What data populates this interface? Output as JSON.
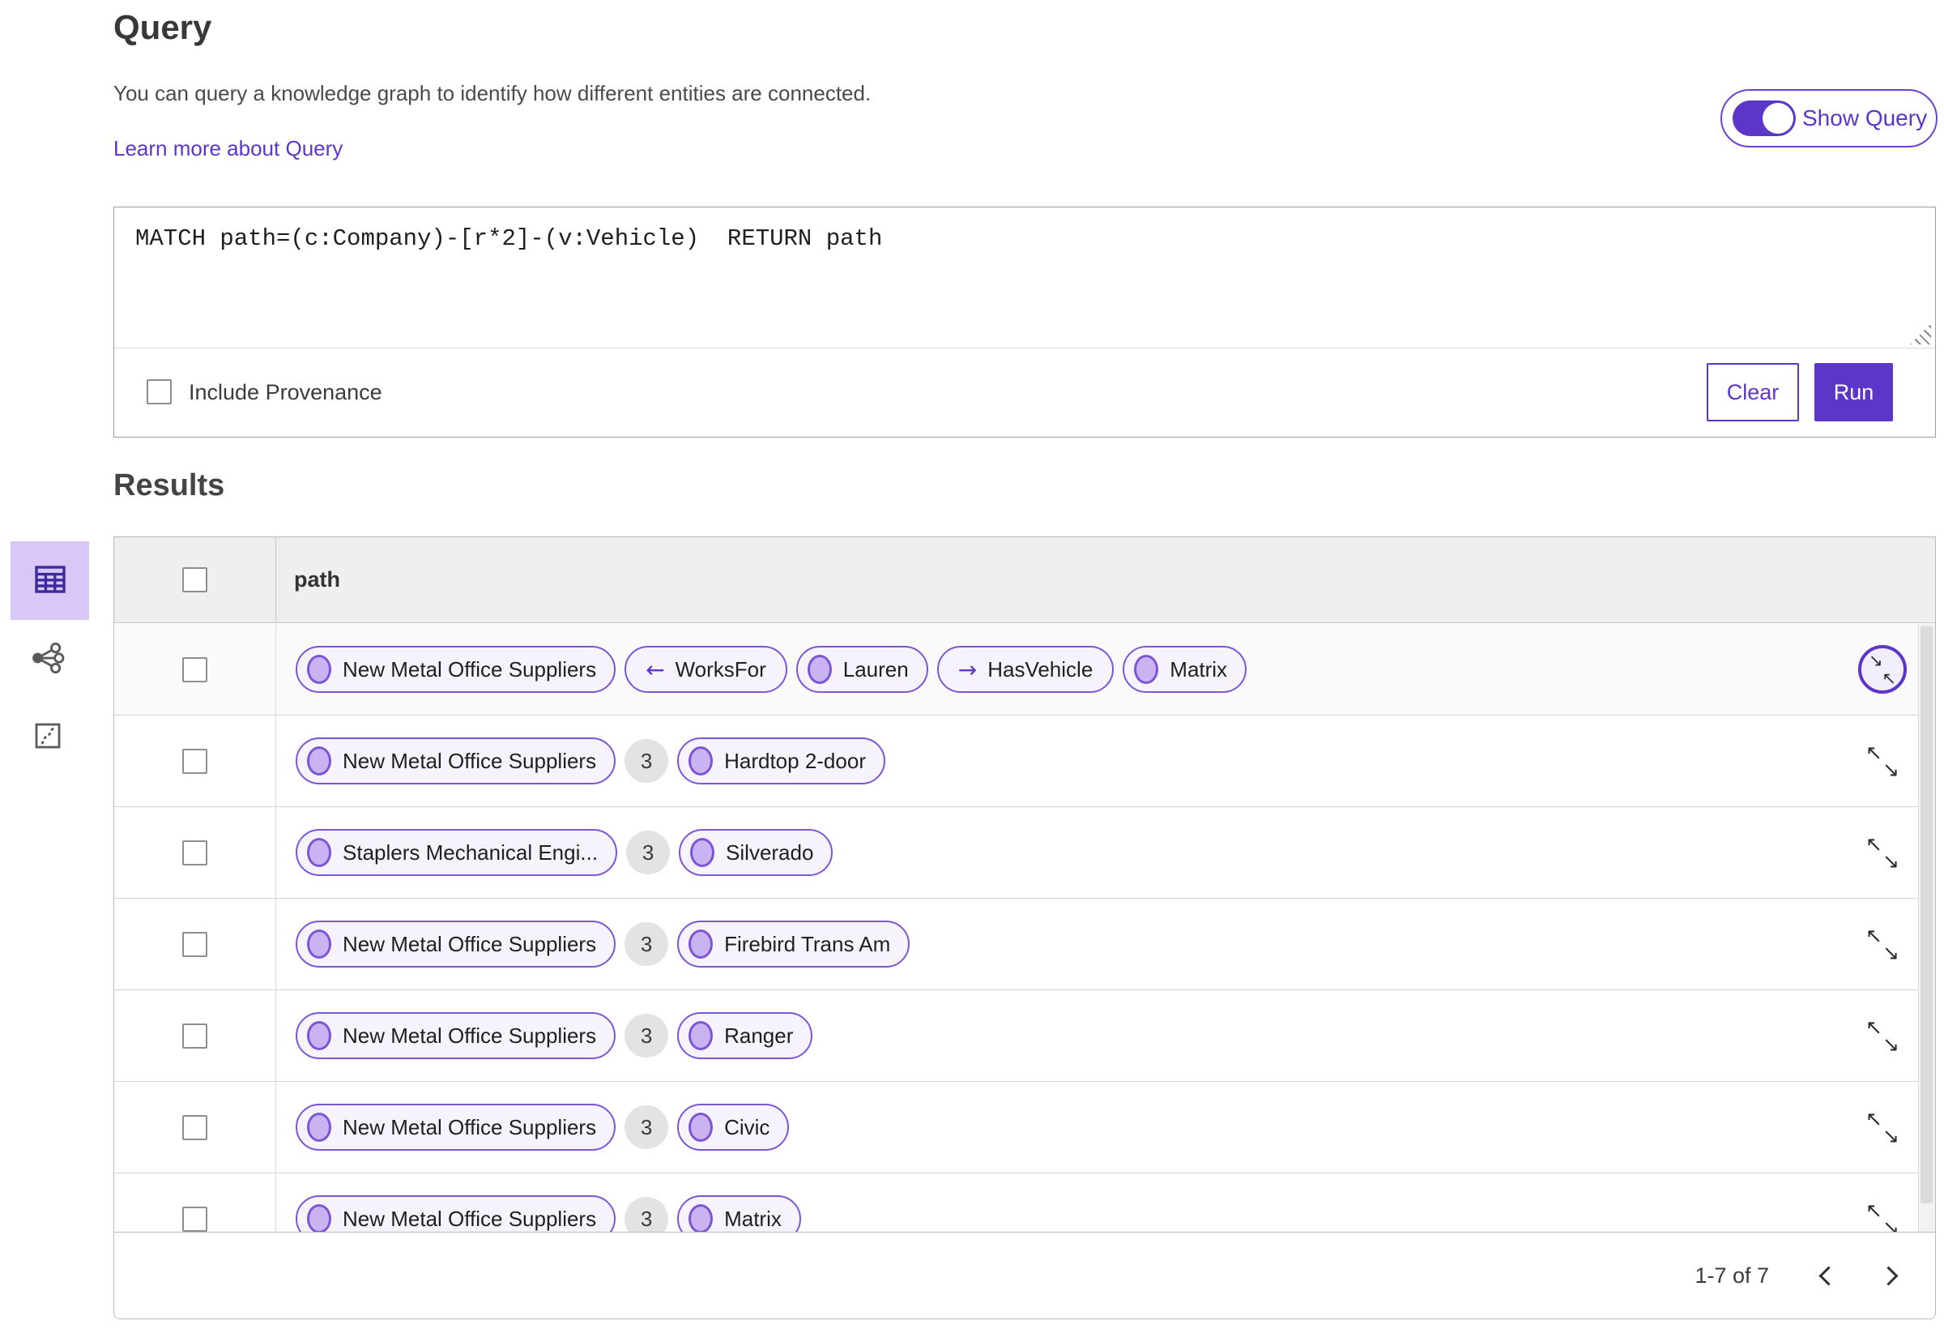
{
  "header": {
    "title": "Query",
    "description": "You can query a knowledge graph to identify how different entities are connected.",
    "learn_more_link": "Learn more about Query",
    "show_query": {
      "label": "Show Query",
      "state": "on"
    }
  },
  "query_editor": {
    "text": "MATCH path=(c:Company)-[r*2]-(v:Vehicle)  RETURN path",
    "include_provenance": {
      "label": "Include Provenance",
      "checked": false
    },
    "buttons": {
      "clear": "Clear",
      "run": "Run"
    }
  },
  "results": {
    "title": "Results",
    "view_rail": [
      {
        "name": "table-view",
        "icon": "table-icon",
        "selected": true
      },
      {
        "name": "link-chart-view",
        "icon": "link-chart-icon",
        "selected": false
      },
      {
        "name": "map-view",
        "icon": "map-icon",
        "selected": false
      }
    ],
    "table": {
      "select_all_checked": false,
      "column_header": "path",
      "rows": [
        {
          "expand_hovered": true,
          "cells": [
            {
              "type": "entity",
              "label": "New Metal Office Suppliers"
            },
            {
              "type": "relationship",
              "arrow": "←",
              "label": "WorksFor"
            },
            {
              "type": "entity",
              "label": "Lauren"
            },
            {
              "type": "relationship",
              "arrow": "→",
              "label": "HasVehicle"
            },
            {
              "type": "entity",
              "label": "Matrix"
            }
          ]
        },
        {
          "expand_hovered": false,
          "cells": [
            {
              "type": "entity",
              "label": "New Metal Office Suppliers"
            },
            {
              "type": "count",
              "label": "3"
            },
            {
              "type": "entity",
              "label": "Hardtop 2-door"
            }
          ]
        },
        {
          "expand_hovered": false,
          "cells": [
            {
              "type": "entity",
              "label": "Staplers Mechanical Engi..."
            },
            {
              "type": "count",
              "label": "3"
            },
            {
              "type": "entity",
              "label": "Silverado"
            }
          ]
        },
        {
          "expand_hovered": false,
          "cells": [
            {
              "type": "entity",
              "label": "New Metal Office Suppliers"
            },
            {
              "type": "count",
              "label": "3"
            },
            {
              "type": "entity",
              "label": "Firebird Trans Am"
            }
          ]
        },
        {
          "expand_hovered": false,
          "cells": [
            {
              "type": "entity",
              "label": "New Metal Office Suppliers"
            },
            {
              "type": "count",
              "label": "3"
            },
            {
              "type": "entity",
              "label": "Ranger"
            }
          ]
        },
        {
          "expand_hovered": false,
          "cells": [
            {
              "type": "entity",
              "label": "New Metal Office Suppliers"
            },
            {
              "type": "count",
              "label": "3"
            },
            {
              "type": "entity",
              "label": "Civic"
            }
          ]
        },
        {
          "expand_hovered": false,
          "cells": [
            {
              "type": "entity",
              "label": "New Metal Office Suppliers"
            },
            {
              "type": "count",
              "label": "3"
            },
            {
              "type": "entity",
              "label": "Matrix"
            }
          ]
        }
      ]
    },
    "pagination": {
      "range_label": "1-7 of 7",
      "prev_icon": "chevron-left-icon",
      "next_icon": "chevron-right-icon"
    }
  },
  "icons": {
    "expand_arrows": [
      "↖",
      "↘"
    ],
    "collapse_arrows": [
      "↘",
      "↖"
    ]
  },
  "colors": {
    "accent": "#5C35C9",
    "pill_border": "#7B57D6",
    "pill_bg": "#F6F3FD",
    "node_fill": "#C9B3F1",
    "selected_view_bg": "#D9C8F7",
    "table_header_bg": "#EFEFEF",
    "badge_bg": "#E3E3E3"
  }
}
